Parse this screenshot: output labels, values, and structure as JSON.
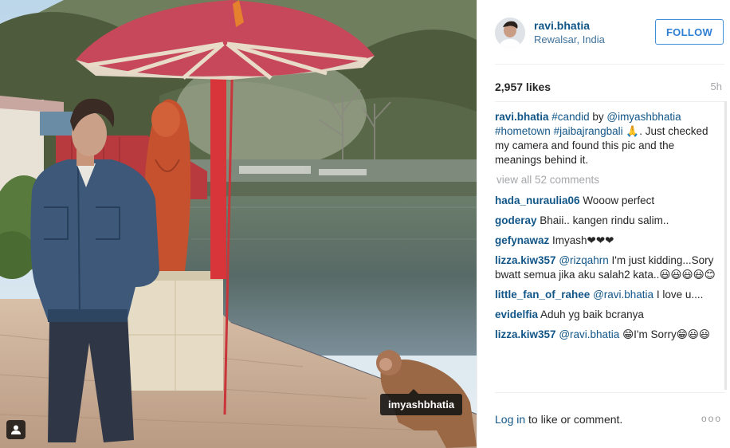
{
  "post": {
    "photo_tag": "imyashbhatia",
    "header": {
      "username": "ravi.bhatia",
      "location": "Rewalsar, India",
      "follow_label": "FOLLOW"
    },
    "likes": "2,957 likes",
    "time_ago": "5h",
    "caption": {
      "user": "ravi.bhatia",
      "text_parts": [
        "#candid",
        " by ",
        "@imyashbhatia",
        " ",
        "#hometown",
        " ",
        "#jaibajrangbali",
        " 🙏. Just checked my camera and found this pic and the meanings behind it."
      ]
    },
    "view_all": "view all 52 comments",
    "comments": [
      {
        "user": "hada_nuraulia06",
        "text": "Wooow perfect"
      },
      {
        "user": "goderay",
        "text": "Bhaii.. kangen rindu salim.."
      },
      {
        "user": "gefynawaz",
        "text": "Imyash❤❤❤"
      },
      {
        "user": "lizza.kiw357",
        "mention": "@rizqahrn",
        "text": " I'm just kidding...Sory bwatt semua jika aku salah2 kata..😃😃😃😃😊"
      },
      {
        "user": "little_fan_of_rahee",
        "mention": "@ravi.bhatia",
        "text": " I love u...."
      },
      {
        "user": "evidelfia",
        "text": "Aduh yg baik bcranya"
      },
      {
        "user": "lizza.kiw357",
        "mention": "@ravi.bhatia",
        "text": " 😁I'm Sorry😁😃😃"
      }
    ],
    "footer": {
      "login_link": "Log in",
      "login_rest": " to like or comment.",
      "more": "ooo"
    }
  },
  "colors": {
    "link": "#125688",
    "follow_border": "#4090db",
    "muted": "#a5a7aa"
  }
}
